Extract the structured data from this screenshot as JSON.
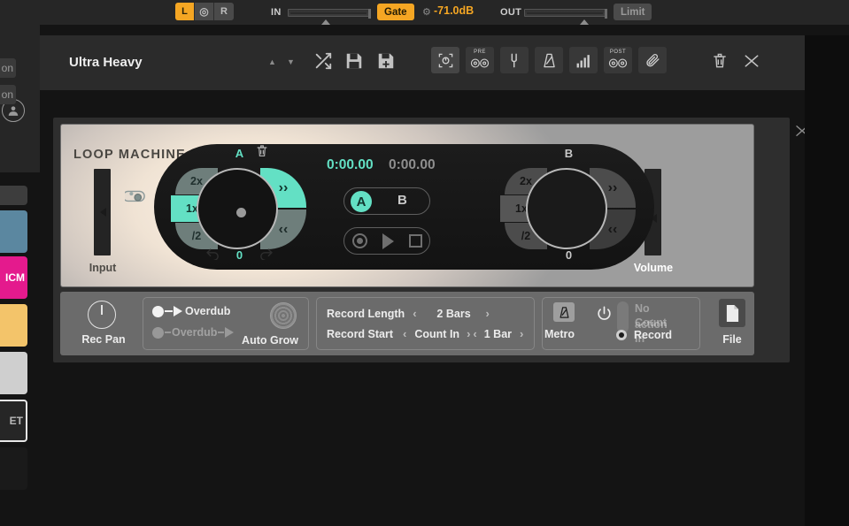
{
  "topbar": {
    "channel_buttons": [
      {
        "label": "L",
        "active": true
      },
      {
        "label": "◎",
        "active": false
      },
      {
        "label": "R",
        "active": false
      }
    ],
    "in_label": "IN",
    "gate_label": "Gate",
    "gear_icon": "⚙",
    "gate_value": "-71.0dB",
    "out_label": "OUT",
    "limit_label": "Limit"
  },
  "sidebar": {
    "chips": [
      "on",
      "on"
    ],
    "swatches": [
      {
        "label": "",
        "color": "#3d3d3d"
      },
      {
        "label": "",
        "color": "#5b87a0"
      },
      {
        "label": "ICM",
        "color": "#e41a8d",
        "text_color": "#ffffff"
      },
      {
        "label": "",
        "color": "#f3c46a"
      },
      {
        "label": "",
        "color": "#cfcfcf"
      },
      {
        "label": "ET",
        "color": "#262626",
        "text_color": "#b9b9b9"
      }
    ]
  },
  "track_header": {
    "title": "Ultra Heavy",
    "up_arrow": "▲",
    "down_arrow": "▼",
    "shuffle_icon": "shuffle",
    "save_icon": "save",
    "save_as_icon": "save-as",
    "icon_buttons": [
      {
        "name": "capture",
        "top_label": ""
      },
      {
        "name": "pre-fx",
        "top_label": "PRE"
      },
      {
        "name": "tuner",
        "top_label": ""
      },
      {
        "name": "metronome",
        "top_label": ""
      },
      {
        "name": "analyzer",
        "top_label": ""
      },
      {
        "name": "post-fx",
        "top_label": "POST"
      },
      {
        "name": "attach",
        "top_label": ""
      }
    ],
    "delete_icon": "trash",
    "collapse_icon": "collapse"
  },
  "plugin": {
    "collapse_icon": "✕",
    "name": "LOOP MACHINE PRO",
    "input_label": "Input",
    "volume_label": "Volume",
    "time_primary": "0:00.00",
    "time_secondary": "0:00.00",
    "ab_a": "A",
    "ab_b": "B",
    "transport": {
      "record": "record",
      "play": "play",
      "stop": "stop"
    },
    "loop_a": {
      "title": "A",
      "trash_icon": "Ὕ1",
      "multipliers": [
        "2x",
        "1x",
        "/2"
      ],
      "active_multiplier": "1x",
      "nudge_forward": "››",
      "nudge_back": "‹‹",
      "value": "0",
      "undo_icon": "↶",
      "redo_icon": "↷",
      "accent": "#63e0c4"
    },
    "loop_b": {
      "title": "B",
      "multipliers": [
        "2x",
        "1x",
        "/2"
      ],
      "active_multiplier": "",
      "nudge_forward": "››",
      "nudge_back": "‹‹",
      "value": "0"
    }
  },
  "controls": {
    "rec_pan_label": "Rec Pan",
    "overdub_on": "Overdub",
    "overdub_off": "Overdub",
    "auto_grow_label": "Auto Grow",
    "record_length_label": "Record Length",
    "record_length_value": "2 Bars",
    "record_start_label": "Record Start",
    "record_start_value": "Count In",
    "record_start_value2": "1 Bar",
    "metro_label": "Metro",
    "power_icon": "⏻",
    "action_options": [
      "No action",
      "Count In",
      "Record"
    ],
    "action_selected": "Record",
    "file_label": "File",
    "prev_arrow": "‹",
    "next_arrow": "›"
  }
}
